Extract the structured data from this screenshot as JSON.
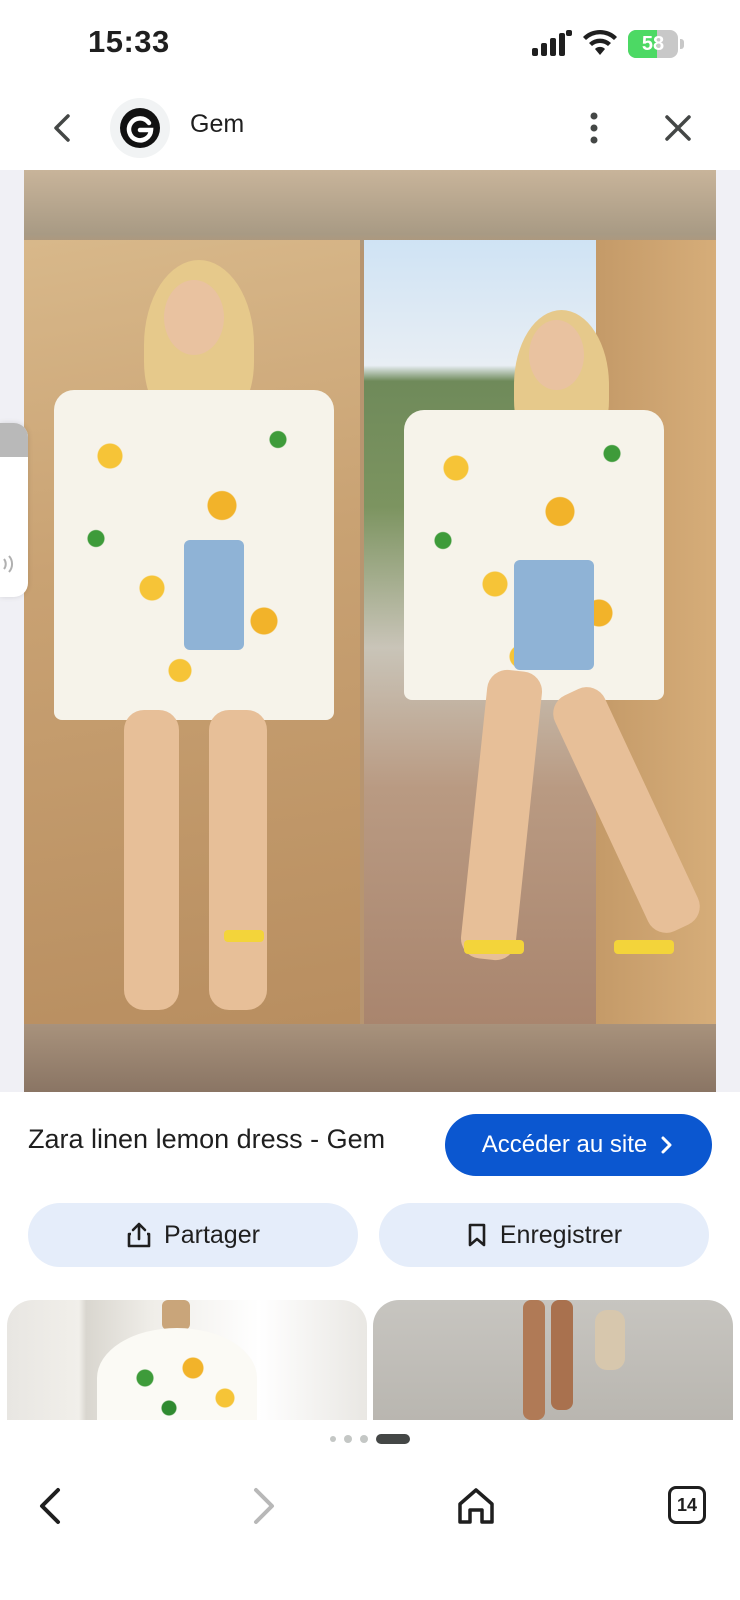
{
  "status_bar": {
    "time": "15:33",
    "battery_level": 58,
    "battery_label": "58"
  },
  "header": {
    "site_name": "Gem",
    "site_icon": "G"
  },
  "result": {
    "caption": "Zara linen lemon dress - Gem",
    "visit_label": "Accéder au site"
  },
  "actions": {
    "share_label": "Partager",
    "save_label": "Enregistrer"
  },
  "carousel": {
    "dot_count": 4,
    "active_index": 3
  },
  "bottom_nav": {
    "tabs_count": "14"
  },
  "colors": {
    "accent": "#0b57d0",
    "chip_bg": "#e5edfa",
    "battery_fill": "#4cd964"
  },
  "icons": {
    "back": "chevron-left-icon",
    "more": "more-vert-icon",
    "close": "close-icon",
    "share": "share-icon",
    "save": "bookmark-icon",
    "nav_back": "arrow-back-icon",
    "nav_forward": "arrow-forward-icon",
    "home": "home-icon",
    "tabs": "tabs-icon"
  }
}
